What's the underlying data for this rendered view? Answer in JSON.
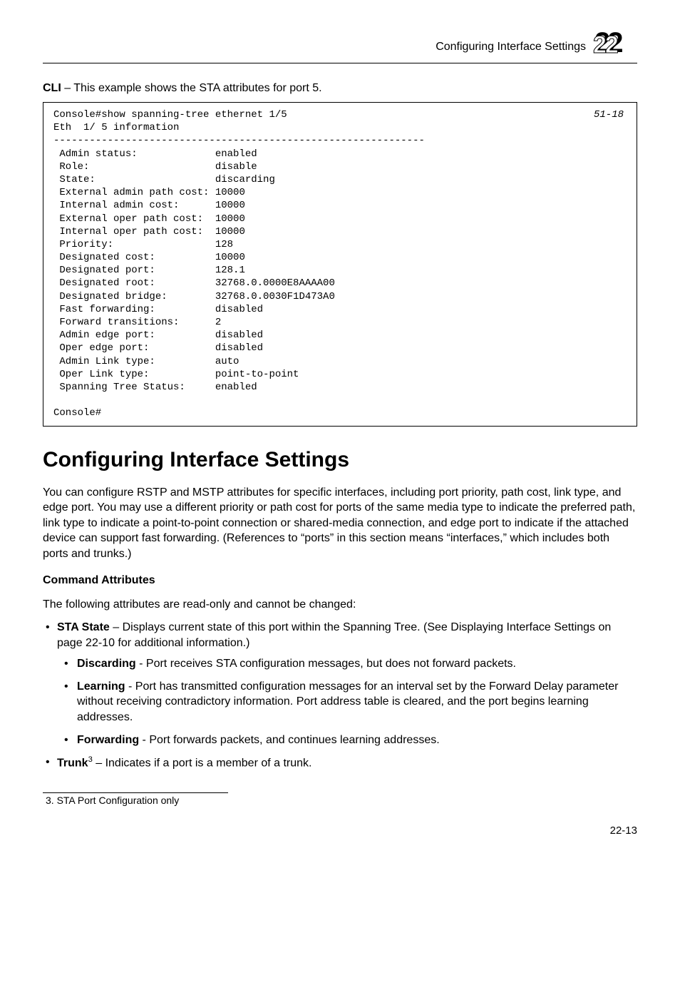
{
  "header": {
    "title": "Configuring Interface Settings",
    "chapter_number": "22"
  },
  "cli_intro_prefix": "CLI",
  "cli_intro_text": " – This example shows the STA attributes for port 5.",
  "cli_pageref": "51-18",
  "cli_block": "Console#show spanning-tree ethernet 1/5\nEth  1/ 5 information\n--------------------------------------------------------------\n Admin status:             enabled\n Role:                     disable\n State:                    discarding\n External admin path cost: 10000\n Internal admin cost:      10000\n External oper path cost:  10000\n Internal oper path cost:  10000\n Priority:                 128\n Designated cost:          10000\n Designated port:          128.1\n Designated root:          32768.0.0000E8AAAA00\n Designated bridge:        32768.0.0030F1D473A0\n Fast forwarding:          disabled\n Forward transitions:      2\n Admin edge port:          disabled\n Oper edge port:           disabled\n Admin Link type:          auto\n Oper Link type:           point-to-point\n Spanning Tree Status:     enabled\n\nConsole#",
  "section_title": "Configuring Interface Settings",
  "section_body": "You can configure RSTP and MSTP attributes for specific interfaces, including port priority, path cost, link type, and edge port. You may use a different priority or path cost for ports of the same media type to indicate the preferred path, link type to indicate a point-to-point connection or shared-media connection, and edge port to indicate if the attached device can support fast forwarding. (References to “ports” in this section means “interfaces,” which includes both ports and trunks.)",
  "command_attributes_heading": "Command Attributes",
  "readonly_intro": "The following attributes are read-only and cannot be changed:",
  "bullets": {
    "sta_state": {
      "label": "STA State",
      "text": " – Displays current state of this port within the Spanning Tree. (See Displaying Interface Settings on page 22-10 for additional information.)",
      "sub": {
        "discarding": {
          "label": "Discarding",
          "text": " - Port receives STA configuration messages, but does not forward packets."
        },
        "learning": {
          "label": "Learning",
          "text": " - Port has transmitted configuration messages for an interval set by the Forward Delay parameter without receiving contradictory information. Port address table is cleared, and the port begins learning addresses."
        },
        "forwarding": {
          "label": "Forwarding",
          "text": " - Port forwards packets, and continues learning addresses."
        }
      }
    },
    "trunk": {
      "label": "Trunk",
      "sup": "3",
      "text": " – Indicates if a port is a member of a trunk."
    }
  },
  "footnote": {
    "num": "3.",
    "text": " STA Port Configuration only"
  },
  "pagenum": "22-13"
}
